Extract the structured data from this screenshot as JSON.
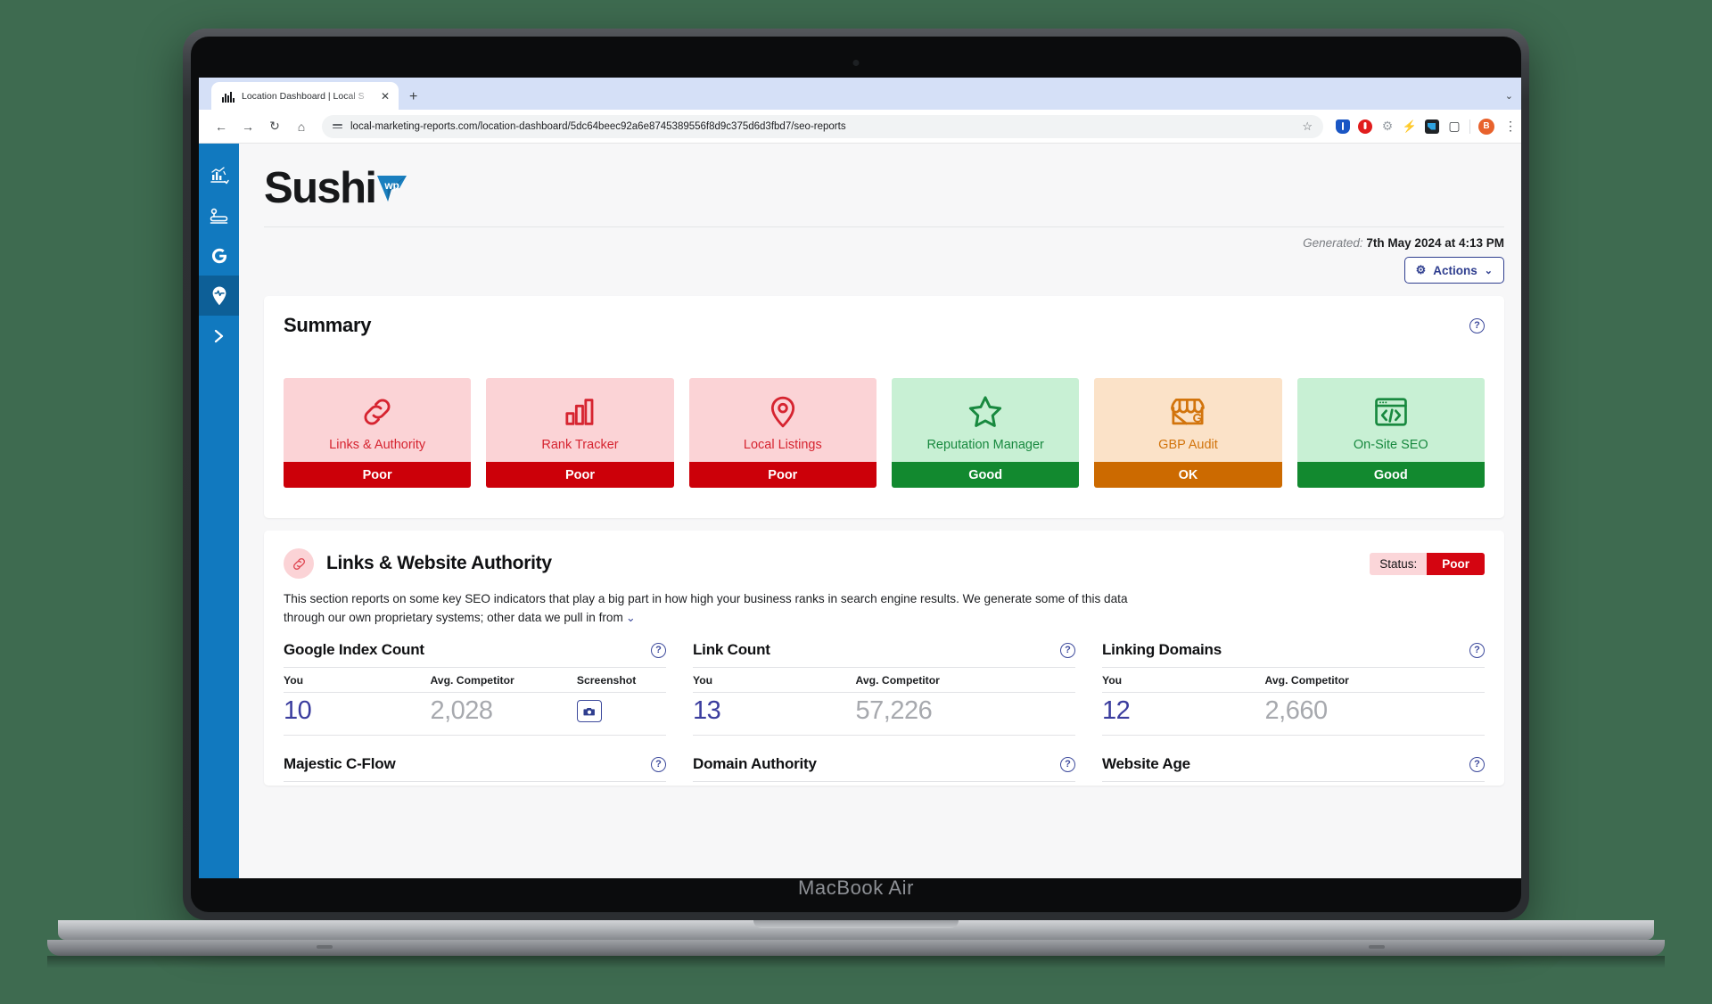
{
  "device": {
    "label": "MacBook Air"
  },
  "browser": {
    "tab": {
      "title": "Location Dashboard | Local S",
      "favicon": "bar-chart-icon",
      "close_label": "✕"
    },
    "new_tab_label": "+",
    "window_caret": "⌄",
    "nav": {
      "back": "←",
      "forward": "→",
      "reload": "↻",
      "home": "⌂"
    },
    "url": "local-marketing-reports.com/location-dashboard/5dc64beec92a6e8745389556f8d9c375d6d3fbd7/seo-reports",
    "bookmark_star": "☆",
    "extensions": [
      "shield-icon",
      "blocker-icon",
      "gear-icon",
      "bolt-icon",
      "clipper-icon",
      "puzzle-icon"
    ],
    "profile_initial": "B",
    "menu_glyph": "⋮"
  },
  "sidebar": {
    "items": [
      {
        "name": "reports-icon",
        "label": "Reports",
        "active": false
      },
      {
        "name": "route-icon",
        "label": "Local Rankings",
        "active": false
      },
      {
        "name": "google-icon",
        "label": "Google",
        "active": false
      },
      {
        "name": "location-pulse-icon",
        "label": "Location Dashboard",
        "active": true
      },
      {
        "name": "expand-chevron-icon",
        "label": "Expand",
        "active": false
      }
    ]
  },
  "header": {
    "logo_text": "Sushi",
    "logo_mark_text": "wp",
    "generated_label": "Generated:",
    "generated_value": "7th May 2024 at 4:13 PM",
    "actions_label": "Actions",
    "actions_gear": "⚙",
    "actions_caret": "⌄"
  },
  "summary": {
    "title": "Summary",
    "help": "?",
    "cards": [
      {
        "label": "Links & Authority",
        "status": "Poor",
        "icon": "link-chain-icon",
        "tone": "poor",
        "bg": "#fbd3d6",
        "fg": "#d62430",
        "bar": "#cc0009"
      },
      {
        "label": "Rank Tracker",
        "status": "Poor",
        "icon": "bar-chart-icon",
        "tone": "poor",
        "bg": "#fbd3d6",
        "fg": "#d62430",
        "bar": "#cc0009"
      },
      {
        "label": "Local Listings",
        "status": "Poor",
        "icon": "map-pin-icon",
        "tone": "poor",
        "bg": "#fbd3d6",
        "fg": "#d62430",
        "bar": "#cc0009"
      },
      {
        "label": "Reputation Manager",
        "status": "Good",
        "icon": "star-icon",
        "tone": "good",
        "bg": "#c8f0d4",
        "fg": "#18893f",
        "bar": "#12892f"
      },
      {
        "label": "GBP Audit",
        "status": "OK",
        "icon": "storefront-g-icon",
        "tone": "ok",
        "bg": "#fbe2c8",
        "fg": "#d2740c",
        "bar": "#cc6a00"
      },
      {
        "label": "On-Site SEO",
        "status": "Good",
        "icon": "code-window-icon",
        "tone": "good",
        "bg": "#c8f0d4",
        "fg": "#18893f",
        "bar": "#12892f"
      }
    ]
  },
  "links_section": {
    "title": "Links & Website Authority",
    "badge_icon": "link-chain-icon",
    "status_label": "Status:",
    "status_value": "Poor",
    "description": "This section reports on some key SEO indicators that play a big part in how high your business ranks in search engine results. We generate some of this data through our own proprietary systems; other data we pull in from",
    "description_caret": "⌄",
    "help": "?",
    "columns": {
      "you": "You",
      "competitor": "Avg. Competitor",
      "screenshot": "Screenshot"
    },
    "metrics_row1": [
      {
        "title": "Google Index Count",
        "you": "10",
        "competitor": "2,028",
        "has_screenshot": true,
        "screenshot_icon": "camera-icon",
        "help": "?"
      },
      {
        "title": "Link Count",
        "you": "13",
        "competitor": "57,226",
        "has_screenshot": false,
        "help": "?"
      },
      {
        "title": "Linking Domains",
        "you": "12",
        "competitor": "2,660",
        "has_screenshot": false,
        "help": "?"
      }
    ],
    "metrics_row2": [
      {
        "title": "Majestic C-Flow",
        "help": "?"
      },
      {
        "title": "Domain Authority",
        "help": "?"
      },
      {
        "title": "Website Age",
        "help": "?"
      }
    ]
  }
}
